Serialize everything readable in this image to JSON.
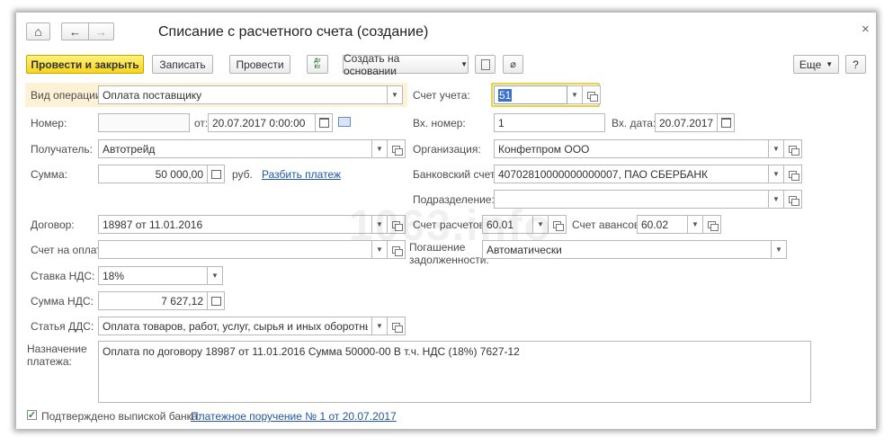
{
  "window": {
    "title": "Списание с расчетного счета (создание)",
    "close": "×"
  },
  "nav": {
    "home": "⌂",
    "back": "←",
    "forward": "→"
  },
  "toolbar": {
    "post_close": "Провести и закрыть",
    "save": "Записать",
    "post": "Провести",
    "dt_kt": "Дт Кт",
    "create_based": "Создать на основании",
    "more": "Еще",
    "help": "?"
  },
  "form": {
    "op_type": {
      "label": "Вид операции:",
      "value": "Оплата поставщику"
    },
    "number": {
      "label": "Номер:",
      "value": ""
    },
    "from": {
      "label": "от:",
      "value": "20.07.2017  0:00:00"
    },
    "recipient": {
      "label": "Получатель:",
      "value": "Автотрейд"
    },
    "sum": {
      "label": "Сумма:",
      "value": "50 000,00",
      "currency": "руб.",
      "split_link": "Разбить платеж"
    },
    "contract": {
      "label": "Договор:",
      "value": "18987 от 11.01.2016"
    },
    "invoice": {
      "label": "Счет на оплату:",
      "value": ""
    },
    "vat_rate": {
      "label": "Ставка НДС:",
      "value": "18%"
    },
    "vat_sum": {
      "label": "Сумма НДС:",
      "value": "7 627,12"
    },
    "dds": {
      "label": "Статья ДДС:",
      "value": "Оплата товаров, работ, услуг, сырья и иных оборотных акти"
    },
    "purpose": {
      "label": "Назначение платежа:",
      "value": "Оплата по договору 18987 от 11.01.2016 Сумма 50000-00 В т.ч. НДС  (18%) 7627-12"
    },
    "account": {
      "label": "Счет учета:",
      "value": "51"
    },
    "in_number": {
      "label": "Вх. номер:",
      "value": "1"
    },
    "in_date": {
      "label": "Вх. дата:",
      "value": "20.07.2017"
    },
    "organization": {
      "label": "Организация:",
      "value": "Конфетпром ООО"
    },
    "bank_account": {
      "label": "Банковский счет:",
      "value": "40702810000000000007, ПАО СБЕРБАНК"
    },
    "division": {
      "label": "Подразделение:",
      "value": ""
    },
    "settle_account": {
      "label": "Счет расчетов:",
      "value": "60.01"
    },
    "advance_account": {
      "label": "Счет авансов:",
      "value": "60.02"
    },
    "debt_repay": {
      "label_line1": "Погашение",
      "label_line2": "задолженности:",
      "value": "Автоматически"
    }
  },
  "footer": {
    "confirmed_label": "Подтверждено выпиской банка:",
    "payment_link": "Платежное поручение № 1 от 20.07.2017"
  },
  "watermark": "1063.info"
}
